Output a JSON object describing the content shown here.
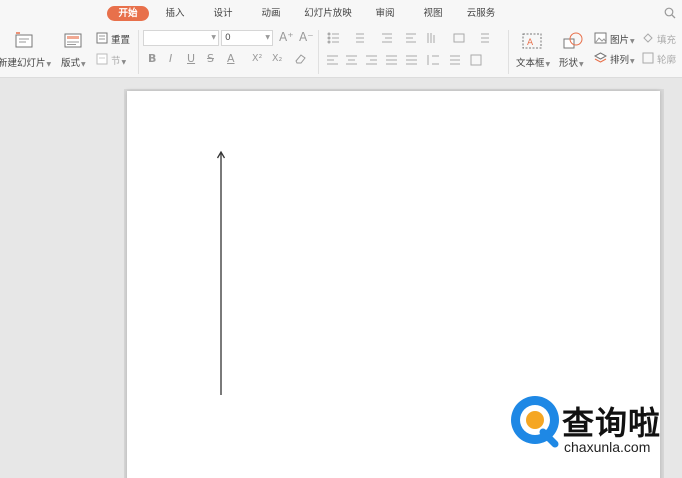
{
  "menu": {
    "tabs": [
      {
        "label": "开始",
        "active": true
      },
      {
        "label": "插入",
        "active": false
      },
      {
        "label": "设计",
        "active": false
      },
      {
        "label": "动画",
        "active": false
      },
      {
        "label": "幻灯片放映",
        "active": false
      },
      {
        "label": "审阅",
        "active": false
      },
      {
        "label": "视图",
        "active": false
      },
      {
        "label": "云服务",
        "active": false
      }
    ]
  },
  "ribbon": {
    "new_slide": "新建幻灯片",
    "layout": "版式",
    "reset": "重置",
    "section": "节",
    "font_name_value": "",
    "font_size_value": "0",
    "font_grow": "A⁺",
    "font_shrink": "A⁻",
    "bold": "B",
    "italic": "I",
    "underline": "U",
    "strike": "S",
    "font_color": "A",
    "superscript": "X²",
    "subscript": "X₂",
    "text_box": "文本框",
    "shape": "形状",
    "picture": "图片",
    "arrange": "排列",
    "fill": "填充",
    "outline": "轮廓"
  },
  "watermark": {
    "title": "查询啦",
    "url": "chaxunla.com"
  },
  "colors": {
    "accent": "#e8704b",
    "watermark_blue": "#1e88e5",
    "watermark_orange": "#f5a623"
  }
}
